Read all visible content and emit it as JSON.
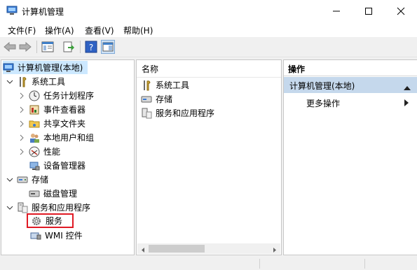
{
  "window": {
    "title": "计算机管理"
  },
  "menu": {
    "items": [
      "文件(F)",
      "操作(A)",
      "查看(V)",
      "帮助(H)"
    ]
  },
  "tree": {
    "root_label": "计算机管理(本地)",
    "system_tools": "系统工具",
    "task_scheduler": "任务计划程序",
    "event_viewer": "事件查看器",
    "shared_folders": "共享文件夹",
    "local_users": "本地用户和组",
    "performance": "性能",
    "device_manager": "设备管理器",
    "storage": "存储",
    "disk_management": "磁盘管理",
    "services_apps": "服务和应用程序",
    "services": "服务",
    "wmi": "WMI 控件"
  },
  "list": {
    "header_name": "名称",
    "rows": [
      "系统工具",
      "存储",
      "服务和应用程序"
    ]
  },
  "actions": {
    "header": "操作",
    "group": "计算机管理(本地)",
    "more": "更多操作"
  },
  "colors": {
    "highlight_box": "#e01a24",
    "action_group_bg": "#c5d8ec",
    "selection_bg": "#cce8ff"
  }
}
